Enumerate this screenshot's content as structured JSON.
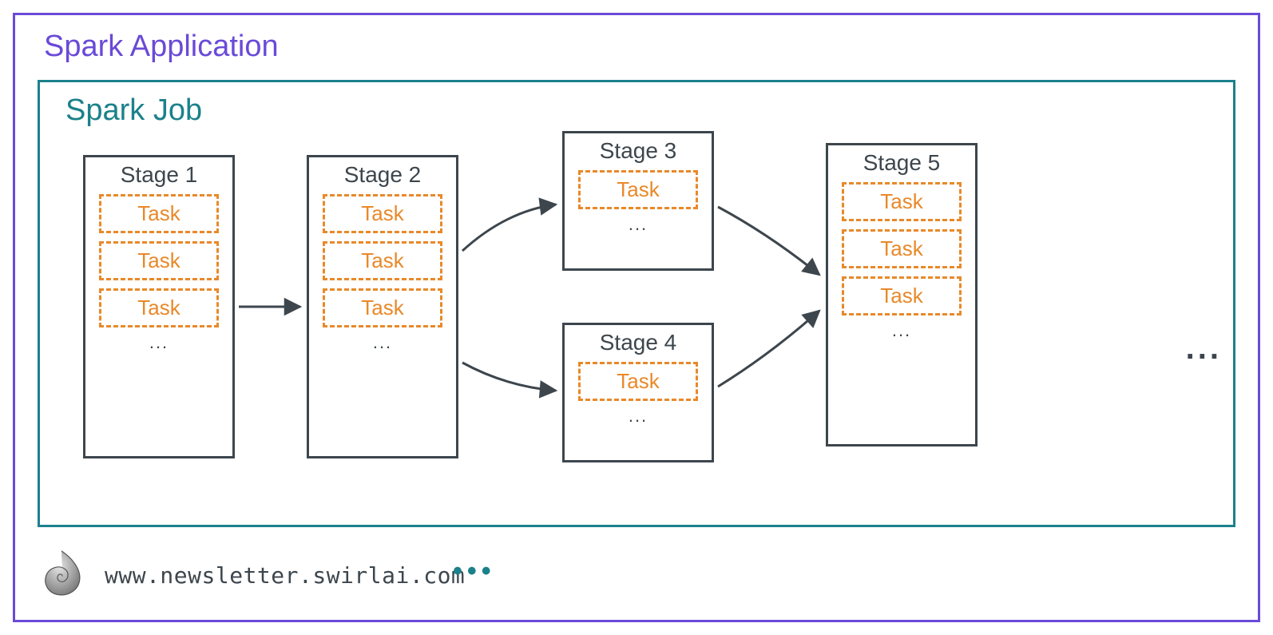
{
  "application": {
    "title": "Spark Application"
  },
  "job": {
    "title": "Spark Job",
    "stages": [
      {
        "label": "Stage 1",
        "tasks": [
          "Task",
          "Task",
          "Task"
        ],
        "ellipsis": "..."
      },
      {
        "label": "Stage 2",
        "tasks": [
          "Task",
          "Task",
          "Task"
        ],
        "ellipsis": "..."
      },
      {
        "label": "Stage 3",
        "tasks": [
          "Task"
        ],
        "ellipsis": "..."
      },
      {
        "label": "Stage 4",
        "tasks": [
          "Task"
        ],
        "ellipsis": "..."
      },
      {
        "label": "Stage 5",
        "tasks": [
          "Task",
          "Task",
          "Task"
        ],
        "ellipsis": "..."
      }
    ],
    "more_side": "...",
    "flow": [
      {
        "from": "Stage 1",
        "to": "Stage 2"
      },
      {
        "from": "Stage 2",
        "to": "Stage 3"
      },
      {
        "from": "Stage 2",
        "to": "Stage 4"
      },
      {
        "from": "Stage 3",
        "to": "Stage 5"
      },
      {
        "from": "Stage 4",
        "to": "Stage 5"
      }
    ]
  },
  "footer": {
    "url": "www.newsletter.swirlai.com",
    "dots": "•••"
  },
  "colors": {
    "outer_border": "#6a4ad8",
    "job_border": "#1b818b",
    "stage_border": "#3d464d",
    "task_border": "#e8892a",
    "task_text": "#e8892a",
    "arrow": "#3d464d"
  }
}
